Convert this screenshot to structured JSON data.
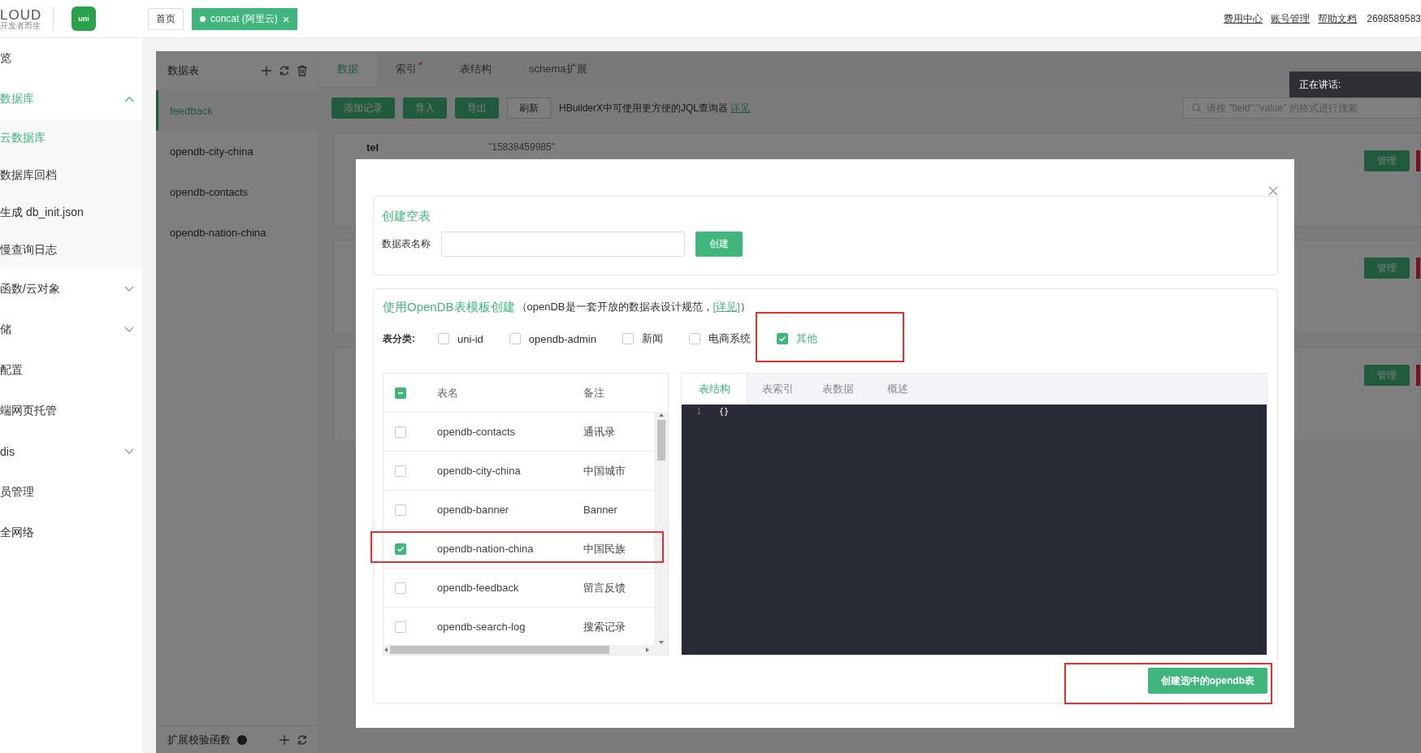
{
  "top_bar": {
    "logo_text": "LOUD",
    "logo_tagline": "开发者而生",
    "app_badge": "uni",
    "tabs": [
      {
        "label": "首页",
        "selected": false
      },
      {
        "label": "concat (阿里云)",
        "selected": true,
        "close": "×"
      }
    ],
    "links": [
      "费用中心",
      "账号管理",
      "帮助文档"
    ],
    "account": "2698589583"
  },
  "sidebar": {
    "items": [
      {
        "label": "览",
        "kind": "link",
        "selected": false
      },
      {
        "label": "数据库",
        "kind": "group",
        "selected": true,
        "expanded": true,
        "children": [
          {
            "label": "云数据库",
            "selected": true
          },
          {
            "label": "数据库回档",
            "selected": false
          },
          {
            "label": "生成 db_init.json",
            "selected": false
          },
          {
            "label": "慢查询日志",
            "selected": false
          }
        ]
      },
      {
        "label": "函数/云对象",
        "kind": "group",
        "selected": false,
        "expanded": false
      },
      {
        "label": "储",
        "kind": "group",
        "selected": false,
        "expanded": false
      },
      {
        "label": "配置",
        "kind": "link",
        "selected": false
      },
      {
        "label": "端网页托管",
        "kind": "link",
        "selected": false
      },
      {
        "label": "dis",
        "kind": "group",
        "selected": false,
        "expanded": false
      },
      {
        "label": "员管理",
        "kind": "link",
        "selected": false
      },
      {
        "label": "全网络",
        "kind": "link",
        "selected": false
      }
    ]
  },
  "tables_panel": {
    "title": "数据表",
    "tables": [
      {
        "name": "feedback",
        "selected": true
      },
      {
        "name": "opendb-city-china",
        "selected": false
      },
      {
        "name": "opendb-contacts",
        "selected": false
      },
      {
        "name": "opendb-nation-china",
        "selected": false
      }
    ],
    "footer_title": "扩展校验函数"
  },
  "tabs": [
    {
      "label": "数据",
      "selected": true
    },
    {
      "label": "索引",
      "selected": false,
      "marker": "*"
    },
    {
      "label": "表结构",
      "selected": false
    },
    {
      "label": "schema扩展",
      "selected": false
    }
  ],
  "toolbar": {
    "buttons": [
      {
        "label": "添加记录",
        "kind": "primary"
      },
      {
        "label": "导入",
        "kind": "primary"
      },
      {
        "label": "导出",
        "kind": "primary"
      },
      {
        "label": "刷新",
        "kind": "default"
      }
    ],
    "hint": "HBuilderX中可使用更方便的JQL查询器",
    "hint_link": "详见",
    "search": {
      "placeholder": "请按 \"field\":\"value\" 的格式进行搜索"
    }
  },
  "records": [
    {
      "field": "tel",
      "value": "\"15838459985\"",
      "action": "管理"
    },
    {
      "action": "管理"
    },
    {
      "action": "管理"
    }
  ],
  "speaking_label": "正在讲话:",
  "modal": {
    "empty_table": {
      "title": "创建空表",
      "name_label": "数据表名称",
      "create_button": "创建"
    },
    "template": {
      "title": "使用OpenDB表模板创建",
      "note_before": "（openDB是一套开放的数据表设计规范，",
      "note_link": "[详见]",
      "note_after": "）",
      "category_label": "表分类:",
      "categories": [
        {
          "label": "uni-id",
          "checked": false,
          "highlighted": false
        },
        {
          "label": "opendb-admin",
          "checked": false,
          "highlighted": false
        },
        {
          "label": "新闻",
          "checked": false,
          "highlighted": false
        },
        {
          "label": "电商系统",
          "checked": false,
          "highlighted": false
        },
        {
          "label": "其他",
          "checked": true,
          "highlighted": true
        }
      ],
      "table": {
        "select_all_indeterminate": true,
        "columns": [
          "表名",
          "备注"
        ],
        "rows": [
          {
            "name": "opendb-contacts",
            "note": "通讯录",
            "checked": false,
            "highlighted": false
          },
          {
            "name": "opendb-city-china",
            "note": "中国城市",
            "checked": false,
            "highlighted": false
          },
          {
            "name": "opendb-banner",
            "note": "Banner",
            "checked": false,
            "highlighted": false
          },
          {
            "name": "opendb-nation-china",
            "note": "中国民族",
            "checked": true,
            "highlighted": true
          },
          {
            "name": "opendb-feedback",
            "note": "留言反馈",
            "checked": false,
            "highlighted": false
          },
          {
            "name": "opendb-search-log",
            "note": "搜索记录",
            "checked": false,
            "highlighted": false
          }
        ]
      },
      "editor": {
        "tabs": [
          {
            "label": "表结构",
            "selected": true
          },
          {
            "label": "表索引",
            "selected": false
          },
          {
            "label": "表数据",
            "selected": false
          },
          {
            "label": "概述",
            "selected": false
          }
        ],
        "lines": [
          {
            "number": "1",
            "code": "{}"
          }
        ]
      },
      "create_button": "创建选中的opendb表",
      "create_button_highlighted": true
    }
  }
}
